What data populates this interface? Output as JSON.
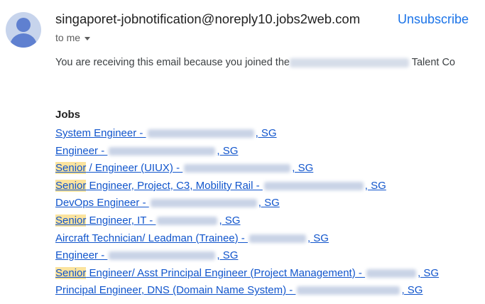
{
  "email": {
    "sender": "singaporet-jobnotification@noreply10.jobs2web.com",
    "unsubscribe": "Unsubscribe",
    "recipient": "to me",
    "intro_before": "You are receiving this email because you joined the",
    "intro_after": " Talent Co"
  },
  "jobs": {
    "heading": "Jobs",
    "items": [
      {
        "highlight": "",
        "title": "System Engineer - ",
        "suffix": ", SG"
      },
      {
        "highlight": "",
        "title": "Engineer - ",
        "suffix": ", SG"
      },
      {
        "highlight": "Senior",
        "title": " / Engineer (UIUX) - ",
        "suffix": ", SG"
      },
      {
        "highlight": "Senior",
        "title": " Engineer, Project, C3, Mobility Rail - ",
        "suffix": ", SG"
      },
      {
        "highlight": "",
        "title": "DevOps Engineer - ",
        "suffix": ", SG"
      },
      {
        "highlight": "Senior",
        "title": " Engineer, IT - ",
        "suffix": ", SG"
      },
      {
        "highlight": "",
        "title": "Aircraft Technician/ Leadman (Trainee) - ",
        "suffix": ", SG"
      },
      {
        "highlight": "",
        "title": "Engineer - ",
        "suffix": ", SG"
      },
      {
        "highlight": "Senior",
        "title": " Engineer/ Asst Principal Engineer (Project Management) - ",
        "suffix": ", SG"
      },
      {
        "highlight": "",
        "title": "Principal Engineer, DNS (Domain Name System) - ",
        "suffix": ", SG"
      }
    ]
  }
}
